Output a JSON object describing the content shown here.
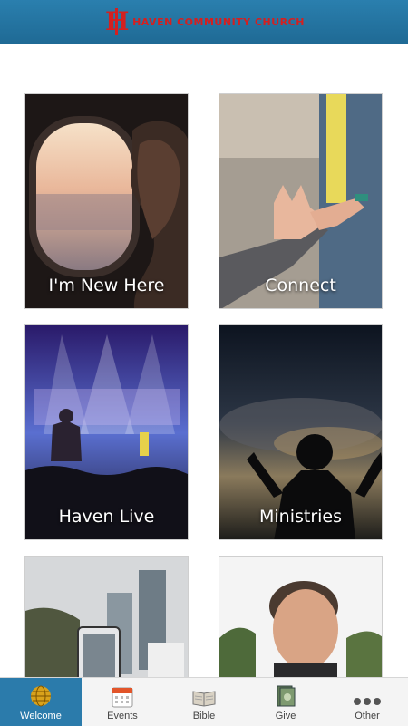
{
  "header": {
    "logo_letter": "H",
    "logo_text": "HAVEN COMMUNITY CHURCH",
    "bg_color": "#2277a5",
    "logo_color": "#d42020"
  },
  "tiles": [
    {
      "label": "I'm New Here",
      "icon": "airplane-window-photo"
    },
    {
      "label": "Connect",
      "icon": "hands-photo"
    },
    {
      "label": "Haven Live",
      "icon": "concert-photo"
    },
    {
      "label": "Ministries",
      "icon": "worship-photo"
    },
    {
      "label": "",
      "icon": "phone-photo"
    },
    {
      "label": "",
      "icon": "pastor-photo"
    }
  ],
  "tabbar": {
    "active_color": "#2b7bab",
    "items": [
      {
        "label": "Welcome",
        "icon": "globe-icon",
        "active": true
      },
      {
        "label": "Events",
        "icon": "calendar-icon"
      },
      {
        "label": "Bible",
        "icon": "book-icon"
      },
      {
        "label": "Give",
        "icon": "money-icon"
      },
      {
        "label": "Other",
        "icon": "more-icon"
      }
    ]
  }
}
